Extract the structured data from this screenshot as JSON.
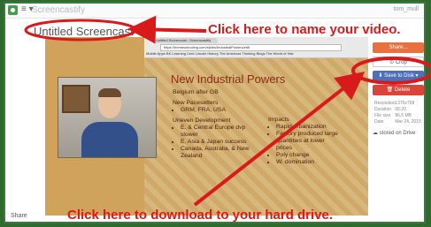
{
  "app": {
    "name": "Screencastify",
    "user": "tom_mull"
  },
  "title": "Untitled Screencast",
  "browser": {
    "tab": "Untitled Screencast - Screencastify",
    "url": "https://homeschooling.com/slides/IndustrialPowers/edit",
    "bookmarks": "Mobile Apps  BK Learning Cent  Lincoln History  The Americas  Thinking Blogs  The World of Hist"
  },
  "slide": {
    "title": "New Industrial Powers",
    "left": {
      "subhead1": "Belgium after GB",
      "subhead2": "New Pacesetters",
      "items1": [
        "GRM, FRA, USA"
      ],
      "subhead3": "Uneven Development",
      "items2": [
        "E. & Central Europe dvp slower",
        "E. Asia & Japan success",
        "Canada, Australia, & New Zealand"
      ]
    },
    "right": {
      "subhead": "Impacts",
      "items": [
        "Rapid urbanization",
        "Factory produced large quantities at lower prices",
        "Poly change",
        "W. domination"
      ]
    }
  },
  "sidebar": {
    "share": "Share...",
    "crop": "Crop",
    "save": "Save to Disk",
    "delete": "Delete",
    "meta": [
      {
        "k": "Resolution",
        "v": "1376x768"
      },
      {
        "k": "Duration",
        "v": "06:20"
      },
      {
        "k": "File size",
        "v": "86.5 MB"
      },
      {
        "k": "Date",
        "v": "Mar 24, 2015"
      }
    ],
    "drive_status": "stored on Drive"
  },
  "share_label": "Share",
  "annotations": {
    "name_video": "Click here to name your video.",
    "download": "Click here to download to your hard drive."
  },
  "colors": {
    "annotation": "#d91a1a",
    "accent_share": "#e8713f",
    "accent_save": "#4f6fb8",
    "accent_delete": "#d9453b"
  }
}
